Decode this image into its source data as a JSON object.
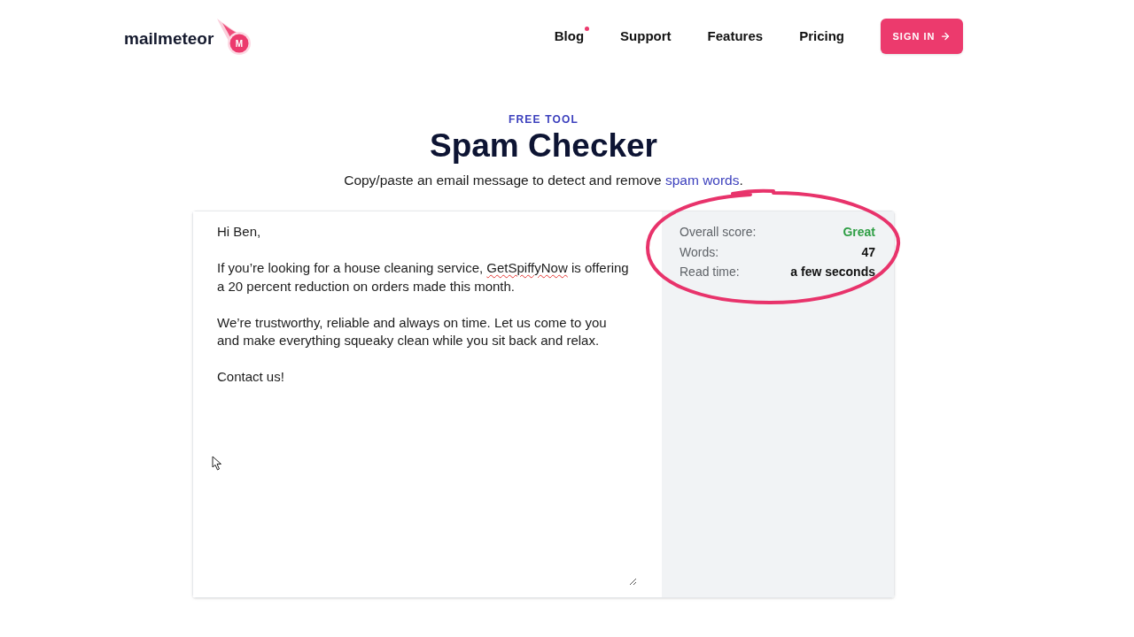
{
  "header": {
    "logo": {
      "wordmark": "mailmeteor",
      "mark": "M"
    },
    "nav": [
      {
        "label": "Blog",
        "dot": true
      },
      {
        "label": "Support",
        "dot": false
      },
      {
        "label": "Features",
        "dot": false
      },
      {
        "label": "Pricing",
        "dot": false
      }
    ],
    "sign_in_button": "SIGN IN"
  },
  "hero": {
    "eyebrow": "FREE TOOL",
    "title": "Spam Checker",
    "subtitle": {
      "text": "Copy/paste an email message to detect and remove ",
      "link": "spam words",
      "after": "."
    }
  },
  "editor": {
    "paragraphs": [
      {
        "lines": [
          [
            {
              "text": "Hi Ben,",
              "misspelled": false
            }
          ]
        ]
      },
      {
        "lines": [
          [
            {
              "text": "If you’re looking for a house cleaning service, ",
              "misspelled": false
            },
            {
              "text": "GetSpiffyNow",
              "misspelled": true
            },
            {
              "text": " is offering",
              "misspelled": false
            }
          ],
          [
            {
              "text": "a 20 percent reduction on orders made this month.",
              "misspelled": false
            }
          ]
        ]
      },
      {
        "lines": [
          [
            {
              "text": "We’re trustworthy, reliable and always on time. Let us come to you",
              "misspelled": false
            }
          ],
          [
            {
              "text": "and make everything squeaky clean while you sit back and relax.",
              "misspelled": false
            }
          ]
        ]
      },
      {
        "lines": [
          [
            {
              "text": "Contact us!",
              "misspelled": false
            }
          ]
        ]
      }
    ]
  },
  "stats": [
    {
      "label": "Overall score:",
      "value": "Great",
      "color": "#2e9e44"
    },
    {
      "label": "Words:",
      "value": "47",
      "color": "#111111"
    },
    {
      "label": "Read time:",
      "value": "a few seconds",
      "color": "#111111"
    }
  ]
}
